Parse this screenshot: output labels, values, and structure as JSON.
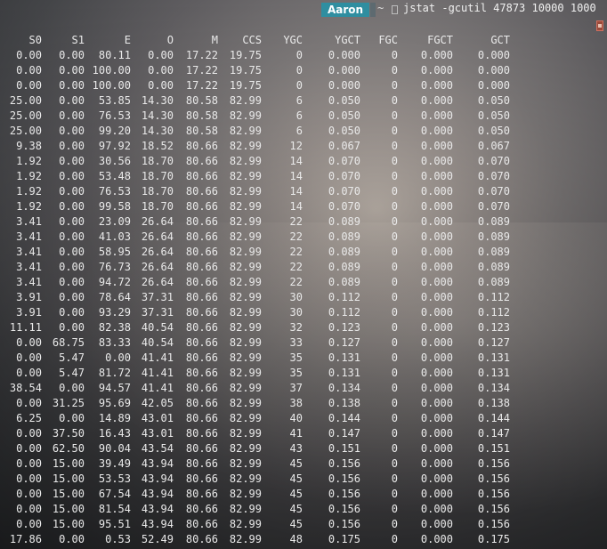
{
  "terminal": {
    "user": "Aaron",
    "cwd": "~",
    "command": "jstat -gcutil 47873 10000 1000"
  },
  "columns": [
    "S0",
    "S1",
    "E",
    "O",
    "M",
    "CCS",
    "YGC",
    "YGCT",
    "FGC",
    "FGCT",
    "GCT"
  ],
  "rows": [
    [
      "0.00",
      "0.00",
      "80.11",
      "0.00",
      "17.22",
      "19.75",
      "0",
      "0.000",
      "0",
      "0.000",
      "0.000"
    ],
    [
      "0.00",
      "0.00",
      "100.00",
      "0.00",
      "17.22",
      "19.75",
      "0",
      "0.000",
      "0",
      "0.000",
      "0.000"
    ],
    [
      "0.00",
      "0.00",
      "100.00",
      "0.00",
      "17.22",
      "19.75",
      "0",
      "0.000",
      "0",
      "0.000",
      "0.000"
    ],
    [
      "25.00",
      "0.00",
      "53.85",
      "14.30",
      "80.58",
      "82.99",
      "6",
      "0.050",
      "0",
      "0.000",
      "0.050"
    ],
    [
      "25.00",
      "0.00",
      "76.53",
      "14.30",
      "80.58",
      "82.99",
      "6",
      "0.050",
      "0",
      "0.000",
      "0.050"
    ],
    [
      "25.00",
      "0.00",
      "99.20",
      "14.30",
      "80.58",
      "82.99",
      "6",
      "0.050",
      "0",
      "0.000",
      "0.050"
    ],
    [
      "9.38",
      "0.00",
      "97.92",
      "18.52",
      "80.66",
      "82.99",
      "12",
      "0.067",
      "0",
      "0.000",
      "0.067"
    ],
    [
      "1.92",
      "0.00",
      "30.56",
      "18.70",
      "80.66",
      "82.99",
      "14",
      "0.070",
      "0",
      "0.000",
      "0.070"
    ],
    [
      "1.92",
      "0.00",
      "53.48",
      "18.70",
      "80.66",
      "82.99",
      "14",
      "0.070",
      "0",
      "0.000",
      "0.070"
    ],
    [
      "1.92",
      "0.00",
      "76.53",
      "18.70",
      "80.66",
      "82.99",
      "14",
      "0.070",
      "0",
      "0.000",
      "0.070"
    ],
    [
      "1.92",
      "0.00",
      "99.58",
      "18.70",
      "80.66",
      "82.99",
      "14",
      "0.070",
      "0",
      "0.000",
      "0.070"
    ],
    [
      "3.41",
      "0.00",
      "23.09",
      "26.64",
      "80.66",
      "82.99",
      "22",
      "0.089",
      "0",
      "0.000",
      "0.089"
    ],
    [
      "3.41",
      "0.00",
      "41.03",
      "26.64",
      "80.66",
      "82.99",
      "22",
      "0.089",
      "0",
      "0.000",
      "0.089"
    ],
    [
      "3.41",
      "0.00",
      "58.95",
      "26.64",
      "80.66",
      "82.99",
      "22",
      "0.089",
      "0",
      "0.000",
      "0.089"
    ],
    [
      "3.41",
      "0.00",
      "76.73",
      "26.64",
      "80.66",
      "82.99",
      "22",
      "0.089",
      "0",
      "0.000",
      "0.089"
    ],
    [
      "3.41",
      "0.00",
      "94.72",
      "26.64",
      "80.66",
      "82.99",
      "22",
      "0.089",
      "0",
      "0.000",
      "0.089"
    ],
    [
      "3.91",
      "0.00",
      "78.64",
      "37.31",
      "80.66",
      "82.99",
      "30",
      "0.112",
      "0",
      "0.000",
      "0.112"
    ],
    [
      "3.91",
      "0.00",
      "93.29",
      "37.31",
      "80.66",
      "82.99",
      "30",
      "0.112",
      "0",
      "0.000",
      "0.112"
    ],
    [
      "11.11",
      "0.00",
      "82.38",
      "40.54",
      "80.66",
      "82.99",
      "32",
      "0.123",
      "0",
      "0.000",
      "0.123"
    ],
    [
      "0.00",
      "68.75",
      "83.33",
      "40.54",
      "80.66",
      "82.99",
      "33",
      "0.127",
      "0",
      "0.000",
      "0.127"
    ],
    [
      "0.00",
      "5.47",
      "0.00",
      "41.41",
      "80.66",
      "82.99",
      "35",
      "0.131",
      "0",
      "0.000",
      "0.131"
    ],
    [
      "0.00",
      "5.47",
      "81.72",
      "41.41",
      "80.66",
      "82.99",
      "35",
      "0.131",
      "0",
      "0.000",
      "0.131"
    ],
    [
      "38.54",
      "0.00",
      "94.57",
      "41.41",
      "80.66",
      "82.99",
      "37",
      "0.134",
      "0",
      "0.000",
      "0.134"
    ],
    [
      "0.00",
      "31.25",
      "95.69",
      "42.05",
      "80.66",
      "82.99",
      "38",
      "0.138",
      "0",
      "0.000",
      "0.138"
    ],
    [
      "6.25",
      "0.00",
      "14.89",
      "43.01",
      "80.66",
      "82.99",
      "40",
      "0.144",
      "0",
      "0.000",
      "0.144"
    ],
    [
      "0.00",
      "37.50",
      "16.43",
      "43.01",
      "80.66",
      "82.99",
      "41",
      "0.147",
      "0",
      "0.000",
      "0.147"
    ],
    [
      "0.00",
      "62.50",
      "90.04",
      "43.54",
      "80.66",
      "82.99",
      "43",
      "0.151",
      "0",
      "0.000",
      "0.151"
    ],
    [
      "0.00",
      "15.00",
      "39.49",
      "43.94",
      "80.66",
      "82.99",
      "45",
      "0.156",
      "0",
      "0.000",
      "0.156"
    ],
    [
      "0.00",
      "15.00",
      "53.53",
      "43.94",
      "80.66",
      "82.99",
      "45",
      "0.156",
      "0",
      "0.000",
      "0.156"
    ],
    [
      "0.00",
      "15.00",
      "67.54",
      "43.94",
      "80.66",
      "82.99",
      "45",
      "0.156",
      "0",
      "0.000",
      "0.156"
    ],
    [
      "0.00",
      "15.00",
      "81.54",
      "43.94",
      "80.66",
      "82.99",
      "45",
      "0.156",
      "0",
      "0.000",
      "0.156"
    ],
    [
      "0.00",
      "15.00",
      "95.51",
      "43.94",
      "80.66",
      "82.99",
      "45",
      "0.156",
      "0",
      "0.000",
      "0.156"
    ],
    [
      "17.86",
      "0.00",
      "0.53",
      "52.49",
      "80.66",
      "82.99",
      "48",
      "0.175",
      "0",
      "0.000",
      "0.175"
    ]
  ],
  "colors": {
    "badge_bg": "#2f8ea0",
    "text": "#e9e9e9"
  }
}
